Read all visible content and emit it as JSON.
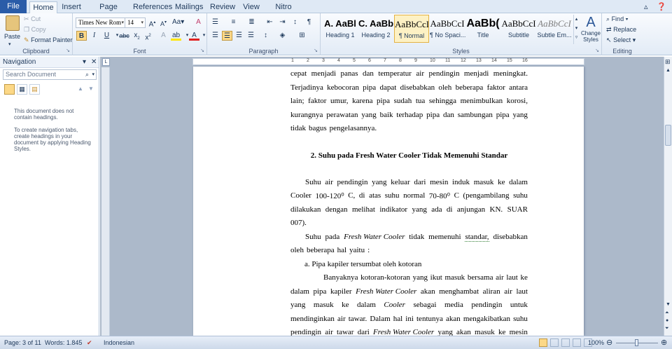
{
  "ribbon_tabs": [
    "File",
    "Home",
    "Insert",
    "Page Layout",
    "References",
    "Mailings",
    "Review",
    "View",
    "Nitro Pro"
  ],
  "clipboard": {
    "paste": "Paste",
    "cut": "Cut",
    "copy": "Copy",
    "format_painter": "Format Painter",
    "group": "Clipboard"
  },
  "font": {
    "name": "Times New Rom",
    "size": "14",
    "group": "Font"
  },
  "paragraph": {
    "group": "Paragraph"
  },
  "styles": {
    "items": [
      {
        "preview": "A. AaBl",
        "name": "Heading 1"
      },
      {
        "preview": "C. AaBb",
        "name": "Heading 2"
      },
      {
        "preview": "AaBbCcI",
        "name": "¶ Normal"
      },
      {
        "preview": "AaBbCcI",
        "name": "¶ No Spaci..."
      },
      {
        "preview": "AaBb(",
        "name": "Title"
      },
      {
        "preview": "AaBbCcI",
        "name": "Subtitle"
      },
      {
        "preview": "AaBbCcI",
        "name": "Subtle Em..."
      }
    ],
    "change": "Change Styles",
    "group": "Styles"
  },
  "editing": {
    "find": "Find",
    "replace": "Replace",
    "select": "Select",
    "group": "Editing"
  },
  "navigation": {
    "title": "Navigation",
    "search_placeholder": "Search Document",
    "msg1": "This document does not contain headings.",
    "msg2": "To create navigation tabs, create headings in your document by applying Heading Styles."
  },
  "ruler_numbers": [
    "1",
    "2",
    "3",
    "4",
    "5",
    "6",
    "7",
    "8",
    "9",
    "10",
    "11",
    "12",
    "13",
    "14",
    "15",
    "16"
  ],
  "document": {
    "lines": [
      {
        "words": [
          "cepat",
          "menjadi",
          "panas",
          "dan",
          "temperatur",
          "air",
          "pendingin",
          "menjadi",
          "meningkat."
        ]
      },
      {
        "words": [
          "Terjadinya",
          "kebocoran",
          "pipa",
          "dapat",
          "disebabkan",
          "oleh",
          "beberapa",
          "faktor",
          "antara"
        ]
      },
      {
        "words": [
          "lain;",
          "faktor",
          "umur,",
          "karena",
          "pipa",
          "sudah",
          "tua",
          "sehingga",
          "menimbulkan",
          "korosi,"
        ]
      },
      {
        "words": [
          "kurangnya",
          "perawatan",
          "yang",
          "baik",
          "terhadap",
          "pipa",
          "dan",
          "sambungan",
          "pipa",
          "yang"
        ]
      },
      {
        "words": [
          "tidak",
          "bagus",
          "pengelasannya."
        ],
        "left": true
      },
      {
        "heading": "2.  Suhu pada Fresh Water Cooler Tidak Memenuhi Standar"
      },
      {
        "words": [
          "Suhu",
          "air",
          "pendingin",
          "yang",
          "keluar",
          "dari",
          "mesin",
          "induk",
          "masuk",
          "ke",
          "dalam"
        ],
        "indent": true
      },
      {
        "words": [
          "Cooler",
          "100-120⁰",
          "C,",
          "di",
          "atas",
          "suhu",
          "normal",
          "70-80⁰",
          "C",
          "(pengambilang",
          "suhu"
        ]
      },
      {
        "words": [
          "dilakukan",
          "dengan",
          "melihat",
          "indikator",
          "yang",
          "ada",
          "di",
          "anjungan",
          "KN.",
          "SUAR"
        ]
      },
      {
        "words": [
          "007)."
        ],
        "left": true
      },
      {
        "words": [
          "Suhu",
          "pada",
          "Fresh Water Cooler",
          "tidak",
          "memenuhi",
          "standar,",
          "disebabkan"
        ],
        "indent": true
      },
      {
        "words": [
          "oleh",
          "beberapa",
          "hal",
          "yaitu",
          ":"
        ],
        "left": true
      },
      {
        "list": "a.  Pipa kapiler tersumbat oleh kotoran"
      },
      {
        "words": [
          "Banyaknya",
          "kotoran-kotoran",
          "yang",
          "ikut",
          "masuk",
          "bersama",
          "air",
          "laut",
          "ke"
        ],
        "indent2": true
      },
      {
        "words": [
          "dalam",
          "pipa",
          "kapiler",
          "Fresh Water Cooler",
          "akan",
          "menghambat",
          "aliran",
          "air",
          "laut"
        ]
      },
      {
        "words": [
          "yang",
          "masuk",
          "ke",
          "dalam",
          "Cooler",
          "sebagai",
          "media",
          "pendingin",
          "untuk"
        ]
      },
      {
        "words": [
          "mendinginkan",
          "air",
          "tawar.",
          "Dalam",
          "hal",
          "ini",
          "tentunya",
          "akan",
          "mengakibatkan",
          "suhu"
        ]
      },
      {
        "words": [
          "pendingin",
          "air",
          "tawar",
          "dari",
          "Fresh Water Cooler",
          "yang",
          "akan",
          "masuk",
          "ke",
          "mesin"
        ]
      }
    ]
  },
  "status": {
    "page": "Page: 3 of 11",
    "words": "Words: 1.845",
    "language": "Indonesian",
    "zoom": "100%"
  }
}
